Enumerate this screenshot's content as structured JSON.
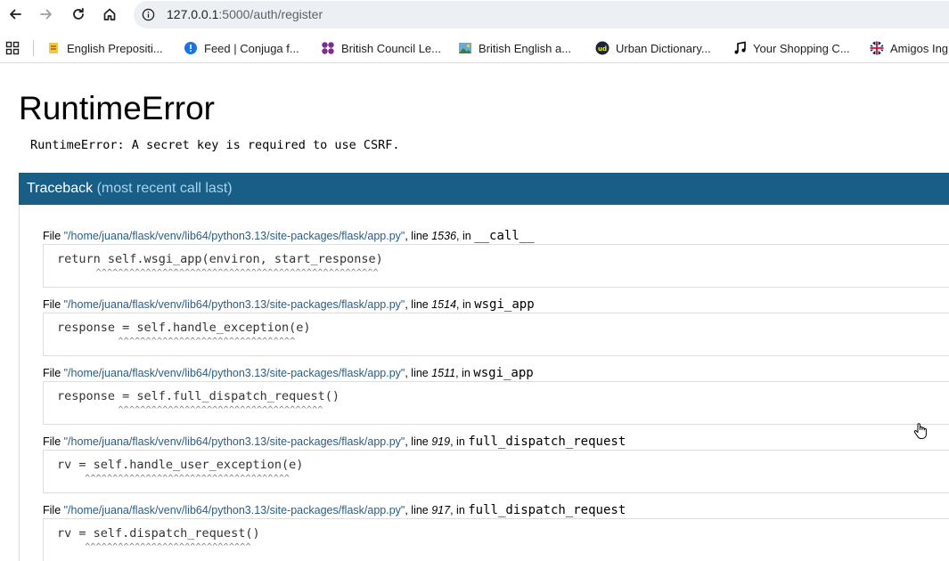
{
  "browser": {
    "url_host": "127.0.0.1",
    "url_rest": ":5000/auth/register",
    "nav": {
      "back_icon": "back-arrow-icon",
      "forward_icon": "forward-arrow-icon",
      "reload_icon": "reload-icon",
      "home_icon": "home-icon",
      "info_icon": "info-icon"
    }
  },
  "bookmarks": [
    {
      "label": "English Prepositi...",
      "icon": "pencil-favicon",
      "color": "#e8a317"
    },
    {
      "label": "Feed | Conjuga f...",
      "icon": "speech-bubble-favicon",
      "color": "#1a73e8"
    },
    {
      "label": "British Council Le...",
      "icon": "british-council-favicon",
      "color": "#7b2d8e"
    },
    {
      "label": "British English a...",
      "icon": "picture-favicon",
      "color": "#3a7d44"
    },
    {
      "label": "Urban Dictionary...",
      "icon": "urban-dictionary-favicon",
      "color": "#1d2439"
    },
    {
      "label": "Your Shopping C...",
      "icon": "music-note-favicon",
      "color": "#000000"
    },
    {
      "label": "Amigos Ing",
      "icon": "uk-flag-favicon",
      "color": "#c8102e"
    }
  ],
  "error": {
    "title": "RuntimeError",
    "message": "RuntimeError: A secret key is required to use CSRF."
  },
  "traceback": {
    "header_main": "Traceback",
    "header_sub": "(most recent call last)",
    "frames": [
      {
        "file_prefix": "File ",
        "path": "\"/home/juana/flask/venv/lib64/python3.13/site-packages/flask/app.py\"",
        "line_label": ", line ",
        "line": "1536",
        "in_label": ", in ",
        "func": "__call__",
        "code": "return self.wsgi_app(environ, start_response)",
        "carets": "       ^^^^^^^^^^^^^^^^^^^^^^^^^^^^^^^^^^^^^^^^^^^^^^^^^^^"
      },
      {
        "file_prefix": "File ",
        "path": "\"/home/juana/flask/venv/lib64/python3.13/site-packages/flask/app.py\"",
        "line_label": ", line ",
        "line": "1514",
        "in_label": ", in ",
        "func": "wsgi_app",
        "code": "response = self.handle_exception(e)",
        "carets": "           ^^^^^^^^^^^^^^^^^^^^^^^^^^^^^^^^"
      },
      {
        "file_prefix": "File ",
        "path": "\"/home/juana/flask/venv/lib64/python3.13/site-packages/flask/app.py\"",
        "line_label": ", line ",
        "line": "1511",
        "in_label": ", in ",
        "func": "wsgi_app",
        "code": "response = self.full_dispatch_request()",
        "carets": "           ^^^^^^^^^^^^^^^^^^^^^^^^^^^^^^^^^^^^^"
      },
      {
        "file_prefix": "File ",
        "path": "\"/home/juana/flask/venv/lib64/python3.13/site-packages/flask/app.py\"",
        "line_label": ", line ",
        "line": "919",
        "in_label": ", in ",
        "func": "full_dispatch_request",
        "code": "rv = self.handle_user_exception(e)",
        "carets": "     ^^^^^^^^^^^^^^^^^^^^^^^^^^^^^^^^^^^^^"
      },
      {
        "file_prefix": "File ",
        "path": "\"/home/juana/flask/venv/lib64/python3.13/site-packages/flask/app.py\"",
        "line_label": ", line ",
        "line": "917",
        "in_label": ", in ",
        "func": "full_dispatch_request",
        "code": "rv = self.dispatch_request()",
        "carets": "     ^^^^^^^^^^^^^^^^^^^^^^^^^^^^^^"
      }
    ]
  },
  "colors": {
    "traceback_header": "#195e86",
    "path_link": "#2a5d82"
  }
}
